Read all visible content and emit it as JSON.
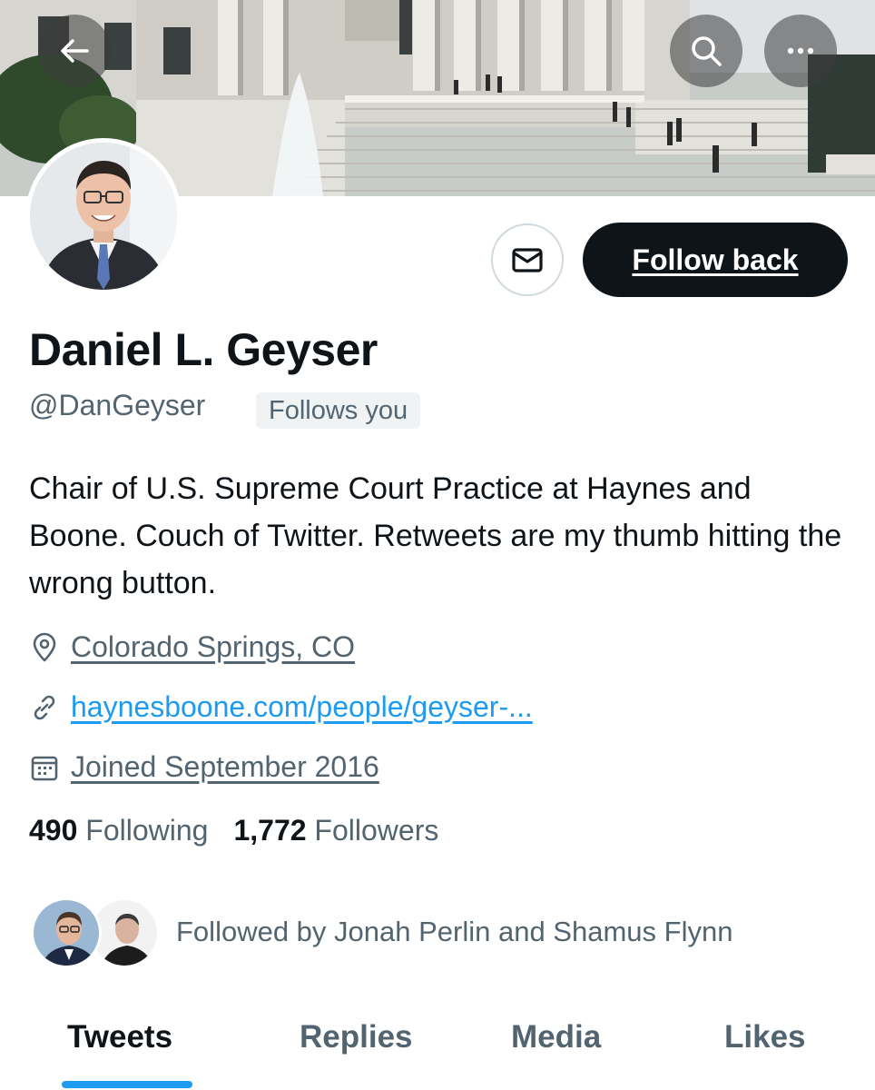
{
  "header": {
    "back_icon": "arrow-left-icon",
    "search_icon": "search-icon",
    "more_icon": "more-horizontal-icon"
  },
  "profile": {
    "name": "Daniel L. Geyser",
    "handle": "@DanGeyser",
    "follows_you_badge": "Follows you",
    "bio": "Chair of U.S. Supreme Court Practice at Haynes and Boone. Couch of Twitter. Retweets are my thumb hitting the wrong button.",
    "location": "Colorado Springs, CO",
    "website": "haynesboone.com/people/geyser-...",
    "joined": "Joined September 2016"
  },
  "actions": {
    "message_icon": "envelope-icon",
    "follow_label": "Follow back"
  },
  "stats": {
    "following_count": "490",
    "following_label": "Following",
    "followers_count": "1,772",
    "followers_label": "Followers"
  },
  "followed_by": {
    "text": "Followed by Jonah Perlin and Shamus Flynn"
  },
  "tabs": [
    {
      "label": "Tweets",
      "active": true
    },
    {
      "label": "Replies",
      "active": false
    },
    {
      "label": "Media",
      "active": false
    },
    {
      "label": "Likes",
      "active": false
    }
  ],
  "colors": {
    "accent": "#1d9bf0",
    "text_primary": "#0f1419",
    "text_secondary": "#536471",
    "button_dark": "#0f1419"
  }
}
